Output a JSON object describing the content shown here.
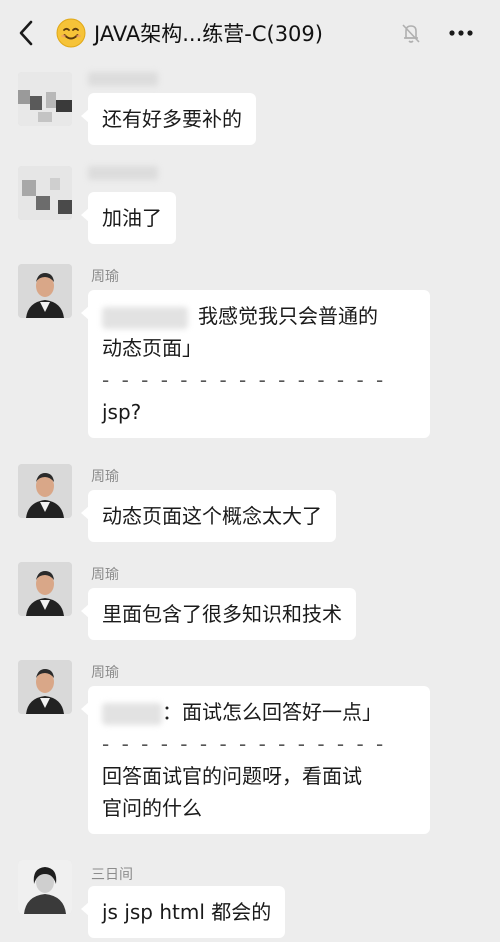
{
  "header": {
    "title": "JAVA架构...练营-C(309)",
    "back_icon": "chevron-left-icon",
    "emoji_icon": "smiling-face-icon",
    "mute_icon": "bell-muted-icon",
    "more_icon": "more-dots-icon"
  },
  "colors": {
    "background": "#ededed",
    "bubble": "#ffffff",
    "sender_name": "#8c8c8c"
  },
  "messages": [
    {
      "sender": "",
      "lines": [
        "还有好多要补的"
      ]
    },
    {
      "sender": "",
      "lines": [
        "加油了"
      ]
    },
    {
      "sender": "周瑜",
      "quote": "我感觉我只会普通的",
      "quote_cont": "动态页面」",
      "divider": "- - - - - - - - - - - - - - -",
      "lines": [
        "jsp?"
      ]
    },
    {
      "sender": "周瑜",
      "lines": [
        "动态页面这个概念太大了"
      ]
    },
    {
      "sender": "周瑜",
      "lines": [
        "里面包含了很多知识和技术"
      ]
    },
    {
      "sender": "周瑜",
      "quote": "：面试怎么回答好一点」",
      "divider": "- - - - - - - - - - - - - - -",
      "lines": [
        "回答面试官的问题呀，看面试",
        "官问的什么"
      ]
    },
    {
      "sender": "三日间",
      "lines": [
        "js jsp html 都会的"
      ]
    }
  ]
}
